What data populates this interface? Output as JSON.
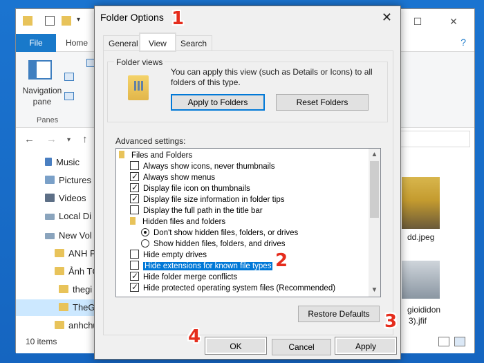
{
  "explorer": {
    "ribbon_tabs": {
      "file": "File",
      "home": "Home"
    },
    "nav_pane_label": "Navigation pane",
    "panes_group_label": "Panes",
    "sidebar": [
      {
        "label": "Music",
        "icon": "music-icon"
      },
      {
        "label": "Pictures",
        "icon": "pictures-icon"
      },
      {
        "label": "Videos",
        "icon": "videos-icon"
      },
      {
        "label": "Local Di",
        "icon": "drive-icon"
      },
      {
        "label": "New Vol",
        "icon": "drive-icon"
      },
      {
        "label": "ANH P",
        "icon": "folder-icon"
      },
      {
        "label": "Ảnh TG",
        "icon": "folder-icon"
      },
      {
        "label": "thegi",
        "icon": "folder-icon"
      },
      {
        "label": "TheG",
        "icon": "folder-icon",
        "selected": true
      },
      {
        "label": "anhchu",
        "icon": "folder-icon"
      }
    ],
    "status": {
      "items": "10 items"
    },
    "files": [
      {
        "label": "dd.jpeg"
      },
      {
        "label": "gioididon"
      },
      {
        "label": "3).jfif"
      }
    ]
  },
  "dialog": {
    "title": "Folder Options",
    "tabs": [
      "General",
      "View",
      "Search"
    ],
    "active_tab": "View",
    "folder_views": {
      "legend": "Folder views",
      "description": "You can apply this view (such as Details or Icons) to all folders of this type.",
      "apply_button": "Apply to Folders",
      "reset_button": "Reset Folders"
    },
    "advanced_label": "Advanced settings:",
    "advanced_items": [
      {
        "type": "folder",
        "label": "Files and Folders"
      },
      {
        "type": "checkbox",
        "label": "Always show icons, never thumbnails",
        "checked": false
      },
      {
        "type": "checkbox",
        "label": "Always show menus",
        "checked": true
      },
      {
        "type": "checkbox",
        "label": "Display file icon on thumbnails",
        "checked": true
      },
      {
        "type": "checkbox",
        "label": "Display file size information in folder tips",
        "checked": true
      },
      {
        "type": "checkbox",
        "label": "Display the full path in the title bar",
        "checked": false
      },
      {
        "type": "folder",
        "label": "Hidden files and folders"
      },
      {
        "type": "radio",
        "label": "Don't show hidden files, folders, or drives",
        "checked": true
      },
      {
        "type": "radio",
        "label": "Show hidden files, folders, and drives",
        "checked": false
      },
      {
        "type": "checkbox",
        "label": "Hide empty drives",
        "checked": false
      },
      {
        "type": "checkbox",
        "label": "Hide extensions for known file types",
        "checked": false,
        "highlighted": true
      },
      {
        "type": "checkbox",
        "label": "Hide folder merge conflicts",
        "checked": true
      },
      {
        "type": "checkbox",
        "label": "Hide protected operating system files (Recommended)",
        "checked": true
      }
    ],
    "restore_button": "Restore Defaults",
    "ok_button": "OK",
    "cancel_button": "Cancel",
    "apply_button": "Apply"
  },
  "annotations": {
    "step1": "1",
    "step2": "2",
    "step3": "3",
    "step4": "4"
  },
  "colors": {
    "selection": "#0078d7",
    "annotation": "#e52d1d",
    "wallpaper": "#1b74d0"
  }
}
